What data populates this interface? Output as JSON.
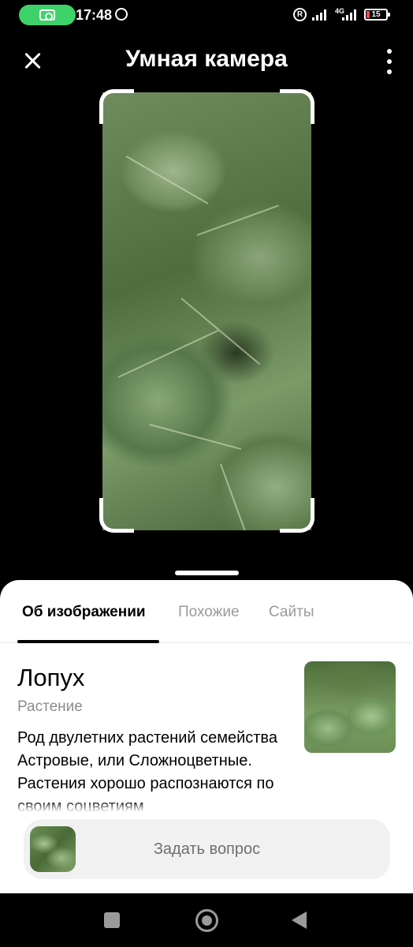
{
  "status_bar": {
    "time": "17:48",
    "network": "4G",
    "battery": "15",
    "icons": [
      "camera-icon",
      "viber-icon",
      "registered-icon",
      "signal-icon",
      "battery-icon"
    ],
    "pill_color": "#3ed36a"
  },
  "header": {
    "title": "Умная камера",
    "icons": [
      "close-icon",
      "more-vertical-icon"
    ]
  },
  "sheet": {
    "tabs": [
      {
        "label": "Об изображении",
        "active": true
      },
      {
        "label": "Похожие",
        "active": false
      },
      {
        "label": "Сайты",
        "active": false
      }
    ],
    "entity": {
      "title": "Лопух",
      "category": "Растение",
      "description": "Род двулетних растений семейства Астровые, или Сложноцветные. Растения хорошо распознаются по своим соцветиям"
    },
    "ask": {
      "label": "Задать вопрос"
    }
  },
  "nav_bar": {
    "icons": [
      "recents-square-icon",
      "home-circle-icon",
      "back-triangle-icon"
    ]
  }
}
